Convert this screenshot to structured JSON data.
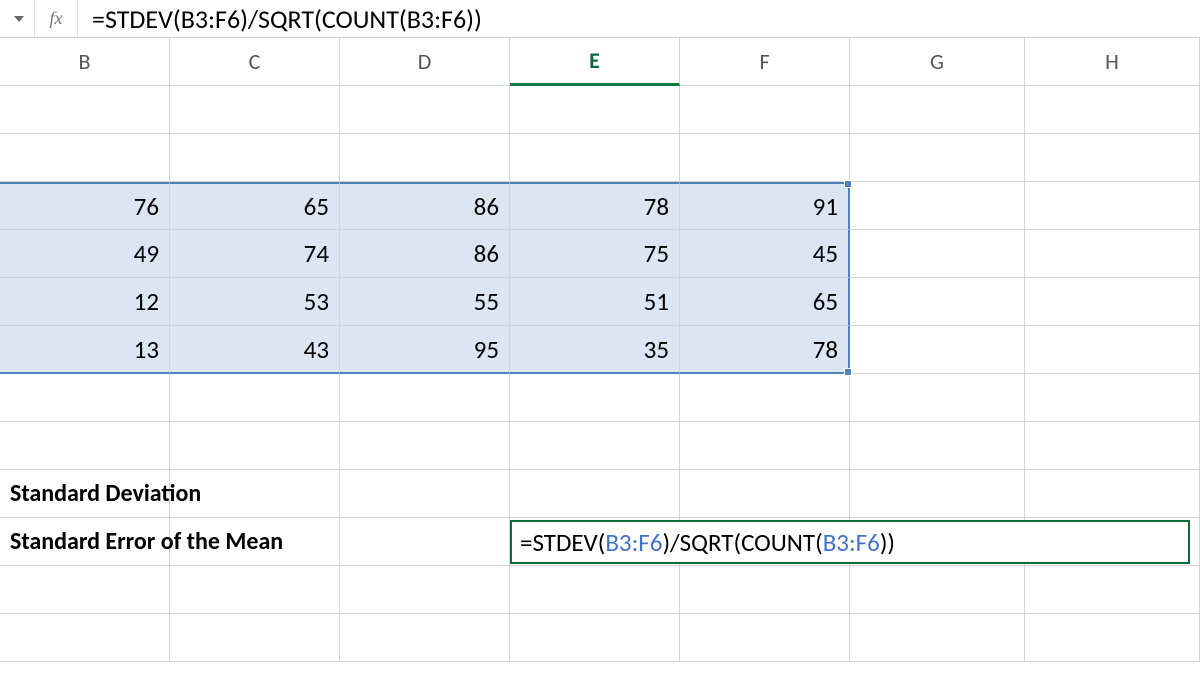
{
  "formula_bar": {
    "fx_label": "fx",
    "formula": "=STDEV(B3:F6)/SQRT(COUNT(B3:F6))"
  },
  "columns": [
    "B",
    "C",
    "D",
    "E",
    "F",
    "G",
    "H"
  ],
  "active_col": "E",
  "data": {
    "r3": {
      "B": "76",
      "C": "65",
      "D": "86",
      "E": "78",
      "F": "91"
    },
    "r4": {
      "B": "49",
      "C": "74",
      "D": "86",
      "E": "75",
      "F": "45"
    },
    "r5": {
      "B": "12",
      "C": "53",
      "D": "55",
      "E": "51",
      "F": "65"
    },
    "r6": {
      "B": "13",
      "C": "43",
      "D": "95",
      "E": "35",
      "F": "78"
    }
  },
  "labels": {
    "std_dev": "Standard Deviation",
    "sem": "Standard Error of the Mean"
  },
  "cell_formula": {
    "prefix": "=STDEV(",
    "ref1": "B3:F6",
    "mid": ")/SQRT(COUNT(",
    "ref2": "B3:F6",
    "suffix": "))"
  }
}
